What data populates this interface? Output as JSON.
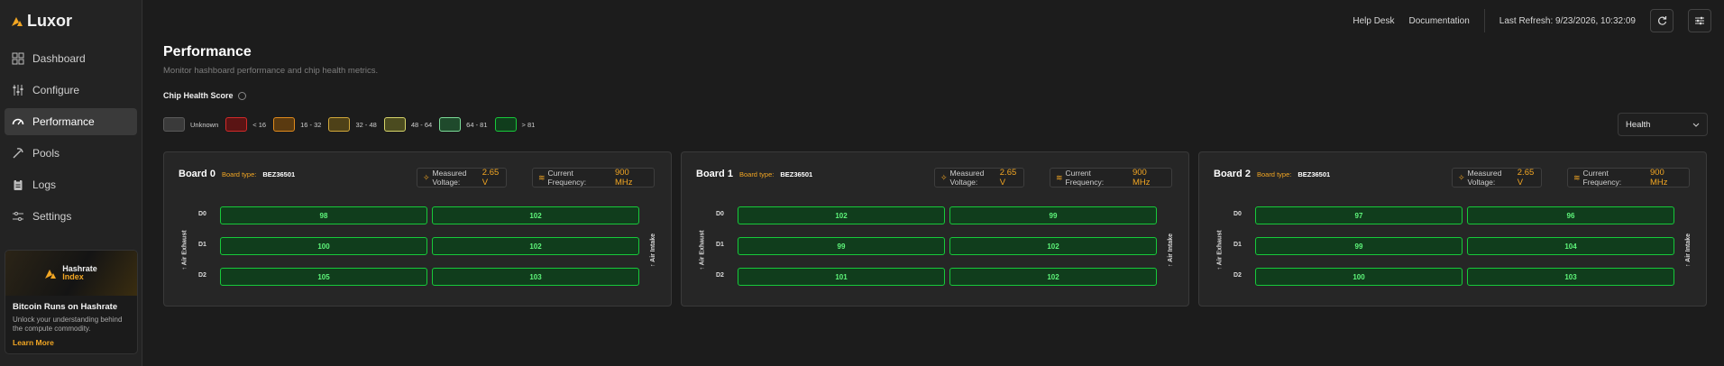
{
  "app": {
    "name": "Luxor"
  },
  "sidebar": {
    "items": [
      {
        "label": "Dashboard",
        "icon": "dashboard-icon"
      },
      {
        "label": "Configure",
        "icon": "sliders-icon"
      },
      {
        "label": "Performance",
        "icon": "gauge-icon",
        "active": true
      },
      {
        "label": "Pools",
        "icon": "pickaxe-icon"
      },
      {
        "label": "Logs",
        "icon": "clipboard-icon"
      },
      {
        "label": "Settings",
        "icon": "settings-icon"
      }
    ],
    "promo": {
      "brand_line1": "Hashrate",
      "brand_line2": "Index",
      "title": "Bitcoin Runs on Hashrate",
      "text": "Unlock your understanding behind the compute commodity.",
      "link": "Learn More"
    }
  },
  "header": {
    "help_desk": "Help Desk",
    "documentation": "Documentation",
    "last_refresh": "Last Refresh: 9/23/2026, 10:32:09"
  },
  "page": {
    "title": "Performance",
    "subtitle": "Monitor hashboard performance and chip health metrics.",
    "chip_health_label": "Chip Health Score"
  },
  "legend": [
    {
      "label": "Unknown",
      "fill": "#3a3a3a",
      "border": "#5a5a5a"
    },
    {
      "label": "< 16",
      "fill": "#5a1414",
      "border": "#d22a2a"
    },
    {
      "label": "16 - 32",
      "fill": "#5a3a10",
      "border": "#e08a1c"
    },
    {
      "label": "32 - 48",
      "fill": "#4e4118",
      "border": "#d2a83a"
    },
    {
      "label": "48 - 64",
      "fill": "#4b4b1f",
      "border": "#d6d46a"
    },
    {
      "label": "64 - 81",
      "fill": "#1f4a2c",
      "border": "#7bdc98"
    },
    {
      "label": "> 81",
      "fill": "#103d1c",
      "border": "#17c93a"
    }
  ],
  "view_select": {
    "value": "Health"
  },
  "boards": [
    {
      "name": "Board 0",
      "type_label": "Board type:",
      "type": "BEZ36501",
      "voltage_label": "Measured Voltage:",
      "voltage": "2.65 V",
      "freq_label": "Current Frequency:",
      "freq": "900 MHz",
      "exhaust": "Air Exhaust",
      "intake": "Air Intake",
      "rows": [
        {
          "label": "D0",
          "values": [
            "98",
            "102"
          ]
        },
        {
          "label": "D1",
          "values": [
            "100",
            "102"
          ]
        },
        {
          "label": "D2",
          "values": [
            "105",
            "103"
          ]
        }
      ]
    },
    {
      "name": "Board 1",
      "type_label": "Board type:",
      "type": "BEZ36501",
      "voltage_label": "Measured Voltage:",
      "voltage": "2.65 V",
      "freq_label": "Current Frequency:",
      "freq": "900 MHz",
      "exhaust": "Air Exhaust",
      "intake": "Air Intake",
      "rows": [
        {
          "label": "D0",
          "values": [
            "102",
            "99"
          ]
        },
        {
          "label": "D1",
          "values": [
            "99",
            "102"
          ]
        },
        {
          "label": "D2",
          "values": [
            "101",
            "102"
          ]
        }
      ]
    },
    {
      "name": "Board 2",
      "type_label": "Board type:",
      "type": "BEZ36501",
      "voltage_label": "Measured Voltage:",
      "voltage": "2.65 V",
      "freq_label": "Current Frequency:",
      "freq": "900 MHz",
      "exhaust": "Air Exhaust",
      "intake": "Air Intake",
      "rows": [
        {
          "label": "D0",
          "values": [
            "97",
            "96"
          ]
        },
        {
          "label": "D1",
          "values": [
            "99",
            "104"
          ]
        },
        {
          "label": "D2",
          "values": [
            "100",
            "103"
          ]
        }
      ]
    }
  ],
  "colors": {
    "accent": "#f2a623",
    "healthy": "#17c93a"
  }
}
